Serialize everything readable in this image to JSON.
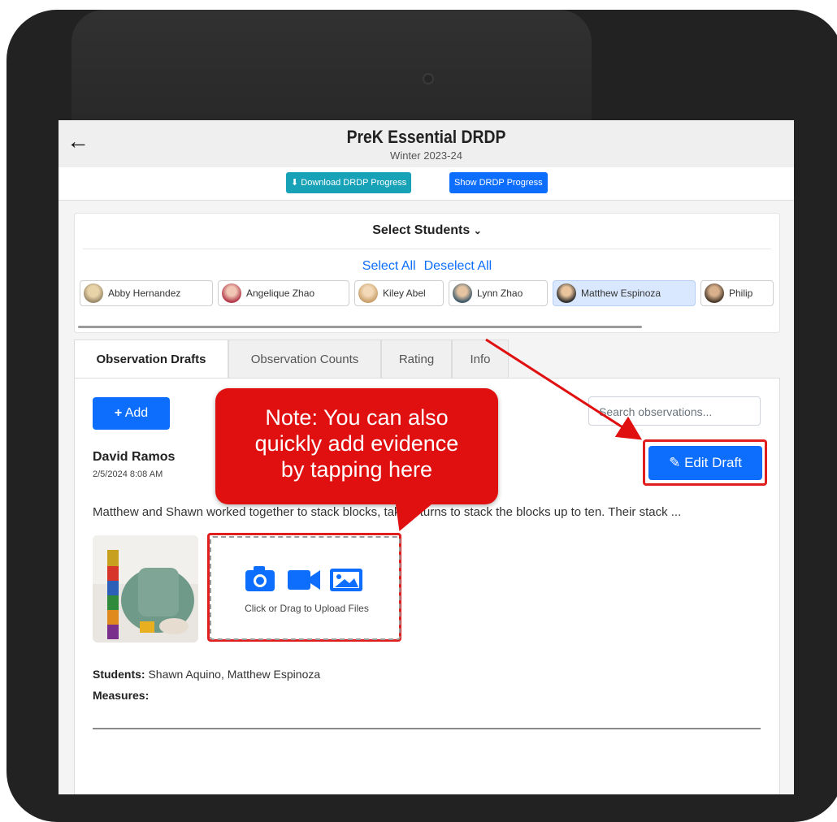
{
  "header": {
    "title": "PreK Essential DRDP",
    "subtitle": "Winter 2023-24",
    "download_label": "Download DRDP Progress",
    "show_label": "Show DRDP Progress"
  },
  "students": {
    "title": "Select Students",
    "select_all": "Select All",
    "deselect_all": "Deselect All",
    "chips": [
      {
        "name": "Abby Hernandez",
        "selected": false
      },
      {
        "name": "Angelique Zhao",
        "selected": false
      },
      {
        "name": "Kiley Abel",
        "selected": false
      },
      {
        "name": "Lynn Zhao",
        "selected": false
      },
      {
        "name": "Matthew Espinoza",
        "selected": true
      },
      {
        "name": "Philip",
        "selected": false
      }
    ]
  },
  "tabs": [
    "Observation Drafts",
    "Observation Counts",
    "Rating",
    "Info"
  ],
  "observation": {
    "add_label": "Add",
    "search_placeholder": "Search observations...",
    "author": "David Ramos",
    "date": "2/5/2024 8:08 AM",
    "edit_label": "Edit Draft",
    "description": "Matthew and Shawn worked together to stack blocks, taking turns to stack the blocks up to ten. Their stack ...",
    "upload_text": "Click or Drag to Upload Files",
    "students_label": "Students:",
    "students_value": "Shawn Aquino, Matthew Espinoza",
    "measures_label": "Measures:"
  },
  "callout": {
    "line1": "Note: You can also",
    "line2": "quickly add evidence",
    "line3": "by tapping here"
  },
  "colors": {
    "primary": "#0d6efd",
    "teal": "#17a2b8",
    "annotation": "#e01010"
  }
}
